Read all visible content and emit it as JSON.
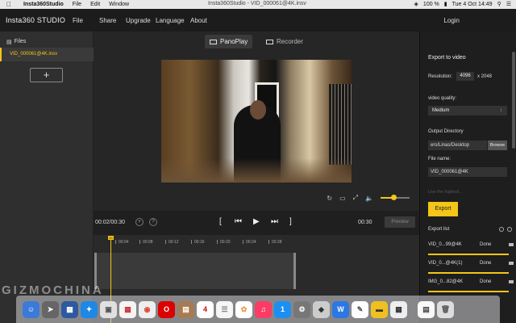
{
  "menubar": {
    "app_name": "Insta360Studio",
    "items": [
      "File",
      "Edit",
      "Window"
    ],
    "window_title": "Insta360Studio - VID_000061@4K.insv",
    "battery": "100 %",
    "clock": "Tue 4 Oct  14:49"
  },
  "appbar": {
    "logo": "Insta360 STUDIO",
    "menu": [
      "File",
      "Share",
      "Upgrade",
      "Language",
      "About"
    ],
    "login": "Login"
  },
  "sidebar": {
    "files_label": "Files",
    "file_name": "VID_000061@4K.insv",
    "add_label": "+"
  },
  "modes": {
    "panoplay": "PanoPlay",
    "recorder": "Recorder"
  },
  "playback": {
    "current_time": "00:02/00:30",
    "end_time": "00:30",
    "preview_label": "Preview",
    "help": "?",
    "volume_level": 0.45
  },
  "timeline": {
    "marker": "00",
    "ticks": [
      "00:04",
      "00:08",
      "00:12",
      "00:16",
      "00:20",
      "00:24",
      "00:28"
    ]
  },
  "export": {
    "title": "Export to video",
    "resolution_label": "Resolution:",
    "res_w": "4096",
    "res_h": "x 2048",
    "quality_label": "video quality:",
    "quality_value": "Medium",
    "dir_label": "Output Directory",
    "dir_value": "ers/Linas/Desktop",
    "browse": "Browse",
    "filename_label": "File name:",
    "filename_value": "VID_000061@4K",
    "faded_option": "Use the highest...",
    "export_btn": "Export",
    "list_label": "Export list",
    "list": [
      {
        "name": "VID_0...99@4K",
        "status": "Done"
      },
      {
        "name": "VID_0...@4K(1)",
        "status": "Done"
      },
      {
        "name": "IMG_0...82@4K",
        "status": "Done"
      }
    ]
  },
  "dock": {
    "calendar_day": "4",
    "badge": "1"
  },
  "watermark": "GIZMOCHINA",
  "colors": {
    "accent": "#f5c518",
    "panel": "#1e1e1e",
    "background": "#262626"
  }
}
